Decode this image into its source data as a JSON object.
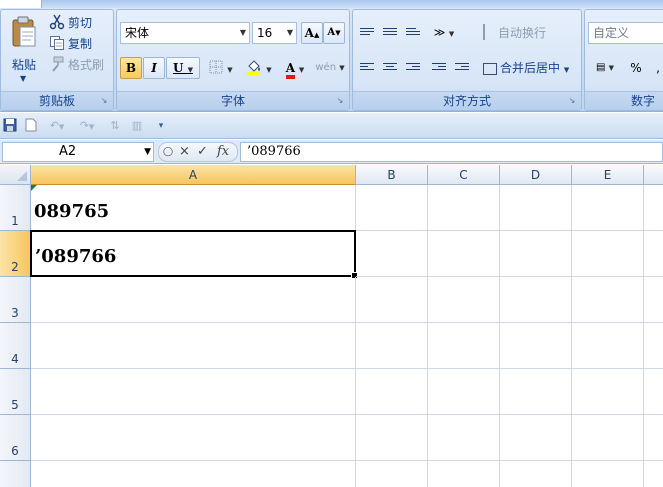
{
  "ribbon": {
    "clipboard": {
      "paste_label": "粘贴",
      "cut_label": "剪切",
      "copy_label": "复制",
      "format_painter_label": "格式刷",
      "group_label": "剪贴板"
    },
    "font": {
      "font_name": "宋体",
      "font_size": "16",
      "bold_label": "B",
      "italic_label": "I",
      "underline_label": "U",
      "grow_label": "A",
      "shrink_label": "A",
      "font_color_label": "A",
      "phonetic_label": "wén",
      "group_label": "字体",
      "font_color_hex": "#e01b1b"
    },
    "alignment": {
      "wrap_text_label": "自动换行",
      "merge_center_label": "合并后居中",
      "group_label": "对齐方式"
    },
    "number": {
      "format_value": "自定义",
      "percent_label": "%",
      "group_label": "数字"
    }
  },
  "formula_bar": {
    "name_box": "A2",
    "cancel_icon": "×",
    "enter_icon": "✓",
    "fx_label": "fx",
    "formula_value": "’089766"
  },
  "grid": {
    "columns": [
      "A",
      "B",
      "C",
      "D",
      "E"
    ],
    "rows": [
      "1",
      "2",
      "3",
      "4",
      "5",
      "6"
    ],
    "cells": {
      "A1": "089765",
      "A2": "’089766"
    },
    "selected_cell": "A2"
  }
}
